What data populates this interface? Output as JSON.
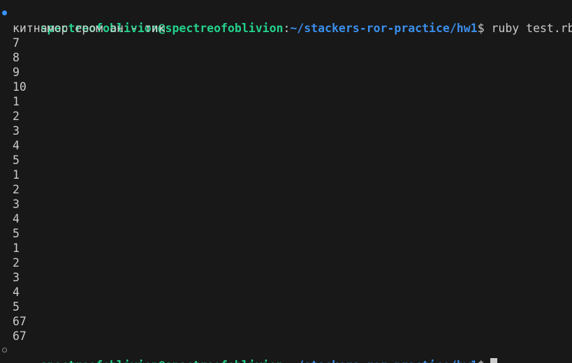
{
  "prompt": {
    "user_host": "spectreofoblivion@spectreofoblivion",
    "colon": ":",
    "path": "~/stackers-ror-practice/hw1",
    "dollar": "$"
  },
  "first_command": {
    "text": " ruby test.rb",
    "decoration": "success-dot"
  },
  "output_lines": [
    "китнамор ером ан - тик",
    "7",
    "8",
    "9",
    "10",
    "1",
    "2",
    "3",
    "4",
    "5",
    "1",
    "2",
    "3",
    "4",
    "5",
    "1",
    "2",
    "3",
    "4",
    "5",
    "67",
    "67"
  ],
  "second_prompt": {
    "decoration": "pending-circle",
    "cursor": "block-cursor"
  },
  "colors": {
    "background": "#181818",
    "text": "#cccccc",
    "user_host": "#23d18b",
    "path": "#3b8eea",
    "success_dot": "#3794ff"
  }
}
